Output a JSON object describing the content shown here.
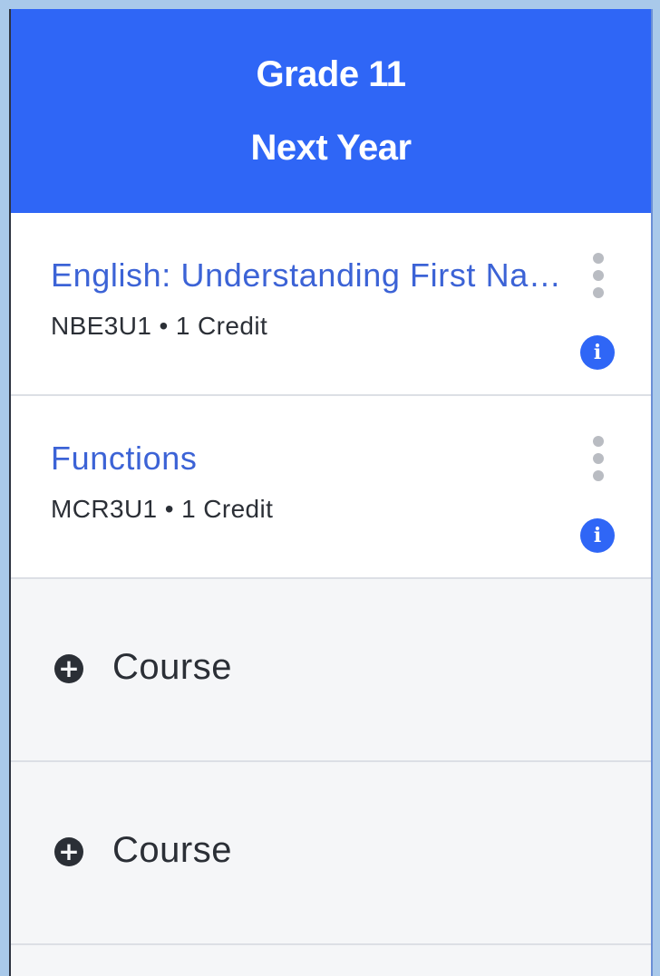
{
  "header": {
    "grade": "Grade 11",
    "year": "Next Year"
  },
  "courses": [
    {
      "title": "English: Understanding First Nations, Métis and Inuit Voices",
      "meta": "NBE3U1 • 1 Credit",
      "more_icon": "vertical-dots-icon",
      "info_icon": "info-icon"
    },
    {
      "title": "Functions",
      "meta": "MCR3U1 • 1 Credit",
      "more_icon": "vertical-dots-icon",
      "info_icon": "info-icon"
    }
  ],
  "empty_slots": [
    {
      "label": "Course",
      "icon": "plus-circle-icon"
    },
    {
      "label": "Course",
      "icon": "plus-circle-icon"
    }
  ],
  "colors": {
    "header_bg": "#2f66f6",
    "link": "#3c63d6",
    "info": "#2f66f6",
    "page_bg": "#a9c9ea"
  }
}
